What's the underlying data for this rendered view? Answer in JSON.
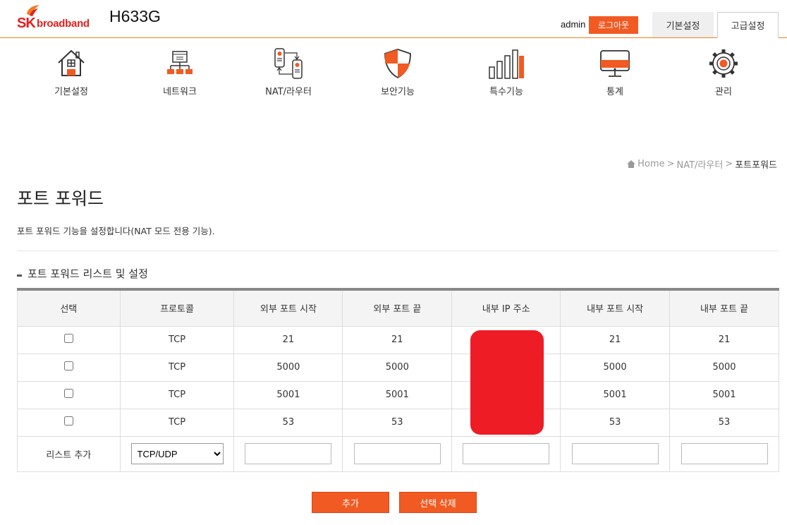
{
  "header": {
    "logo_sk": "SK",
    "logo_broadband": "broadband",
    "model": "H633G",
    "user": "admin",
    "logout_label": "로그아웃",
    "tab_basic": "기본설정",
    "tab_advanced": "고급설정"
  },
  "nav": {
    "items": [
      {
        "label": "기본설정",
        "icon": "house-icon"
      },
      {
        "label": "네트워크",
        "icon": "network-icon"
      },
      {
        "label": "NAT/라우터",
        "icon": "router-icon"
      },
      {
        "label": "보안기능",
        "icon": "shield-icon"
      },
      {
        "label": "특수기능",
        "icon": "signal-bars-icon"
      },
      {
        "label": "통계",
        "icon": "monitor-icon"
      },
      {
        "label": "관리",
        "icon": "gear-icon"
      }
    ]
  },
  "breadcrumb": {
    "home": "Home",
    "sep": ">",
    "level1": "NAT/라우터",
    "current": "포트포워드"
  },
  "page": {
    "title": "포트 포워드",
    "description": "포트 포워드 기능을 설정합니다(NAT 모드 전용 기능).",
    "section_title": "포트 포워드 리스트 및 설정"
  },
  "table": {
    "headers": [
      "선택",
      "프로토콜",
      "외부 포트 시작",
      "외부 포트 끝",
      "내부 IP 주소",
      "내부 포트 시작",
      "내부 포트 끝"
    ],
    "rows": [
      {
        "protocol": "TCP",
        "ext_start": "21",
        "ext_end": "21",
        "ip": "",
        "int_start": "21",
        "int_end": "21"
      },
      {
        "protocol": "TCP",
        "ext_start": "5000",
        "ext_end": "5000",
        "ip": "",
        "int_start": "5000",
        "int_end": "5000"
      },
      {
        "protocol": "TCP",
        "ext_start": "5001",
        "ext_end": "5001",
        "ip": "",
        "int_start": "5001",
        "int_end": "5001"
      },
      {
        "protocol": "TCP",
        "ext_start": "53",
        "ext_end": "53",
        "ip": "",
        "int_start": "53",
        "int_end": "53"
      }
    ],
    "add_row_label": "리스트 추가",
    "protocol_selected": "TCP/UDP"
  },
  "buttons": {
    "add": "추가",
    "delete_selected": "선택 삭제"
  },
  "colors": {
    "accent": "#f15a22",
    "brand": "#e0201f",
    "redaction": "#ee1c25"
  }
}
